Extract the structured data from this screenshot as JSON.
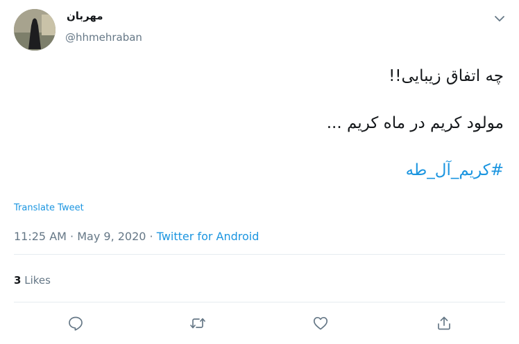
{
  "user": {
    "display_name": "مهربان",
    "handle": "@hhmehraban",
    "avatar_icon": "avatar-photo"
  },
  "tweet": {
    "lines": [
      "چه اتفاق زیبایی!!",
      "مولود کریم در ماه کریم ..."
    ],
    "hashtag": "#کریم_آل_طه",
    "translate_label": "Translate Tweet",
    "time": "11:25 AM",
    "date": "May 9, 2020",
    "source": "Twitter for Android"
  },
  "stats": {
    "likes_count": "3",
    "likes_label": "Likes"
  },
  "actions": {
    "reply_icon": "reply-icon",
    "retweet_icon": "retweet-icon",
    "like_icon": "heart-icon",
    "share_icon": "share-icon"
  },
  "colors": {
    "link": "#1b95e0",
    "secondary": "#657786",
    "text": "#14171a",
    "divider": "#e6ecf0"
  }
}
